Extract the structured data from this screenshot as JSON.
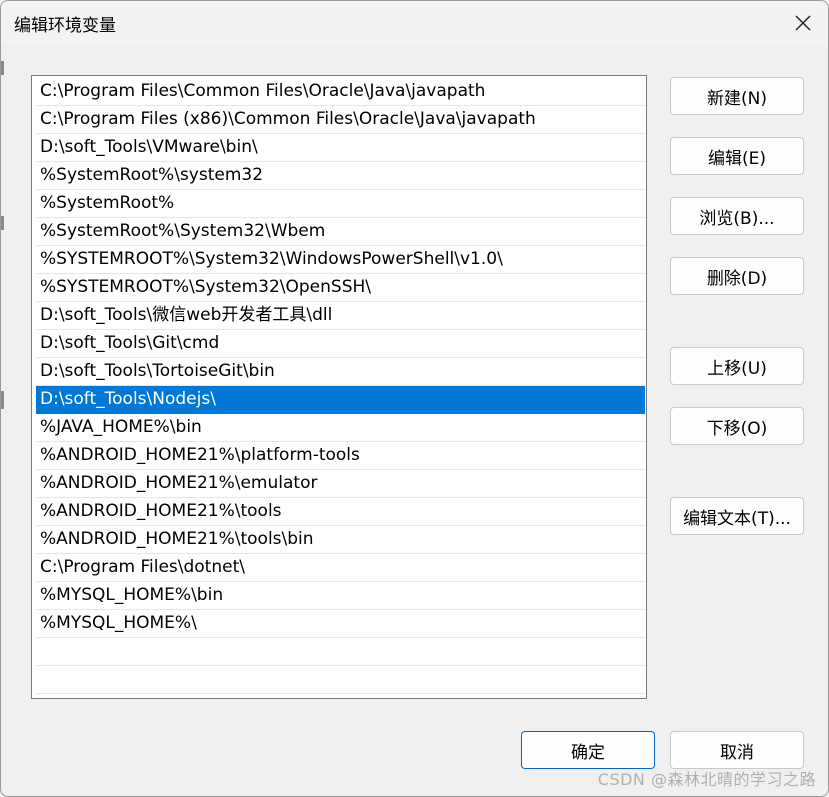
{
  "window": {
    "title": "编辑环境变量"
  },
  "list": {
    "items": [
      "C:\\Program Files\\Common Files\\Oracle\\Java\\javapath",
      "C:\\Program Files (x86)\\Common Files\\Oracle\\Java\\javapath",
      "D:\\soft_Tools\\VMware\\bin\\",
      "%SystemRoot%\\system32",
      "%SystemRoot%",
      "%SystemRoot%\\System32\\Wbem",
      "%SYSTEMROOT%\\System32\\WindowsPowerShell\\v1.0\\",
      "%SYSTEMROOT%\\System32\\OpenSSH\\",
      "D:\\soft_Tools\\微信web开发者工具\\dll",
      "D:\\soft_Tools\\Git\\cmd",
      "D:\\soft_Tools\\TortoiseGit\\bin",
      "D:\\soft_Tools\\Nodejs\\",
      "%JAVA_HOME%\\bin",
      "%ANDROID_HOME21%\\platform-tools",
      "%ANDROID_HOME21%\\emulator",
      "%ANDROID_HOME21%\\tools",
      "%ANDROID_HOME21%\\tools\\bin",
      "C:\\Program Files\\dotnet\\",
      "%MYSQL_HOME%\\bin",
      "%MYSQL_HOME%\\"
    ],
    "selected_index": 11
  },
  "buttons": {
    "new": "新建(N)",
    "edit": "编辑(E)",
    "browse": "浏览(B)...",
    "delete": "删除(D)",
    "move_up": "上移(U)",
    "move_down": "下移(O)",
    "edit_text": "编辑文本(T)...",
    "ok": "确定",
    "cancel": "取消"
  },
  "watermark": "CSDN @森林北晴的学习之路",
  "colors": {
    "selection": "#0078d7",
    "primary_border": "#0067c0"
  }
}
